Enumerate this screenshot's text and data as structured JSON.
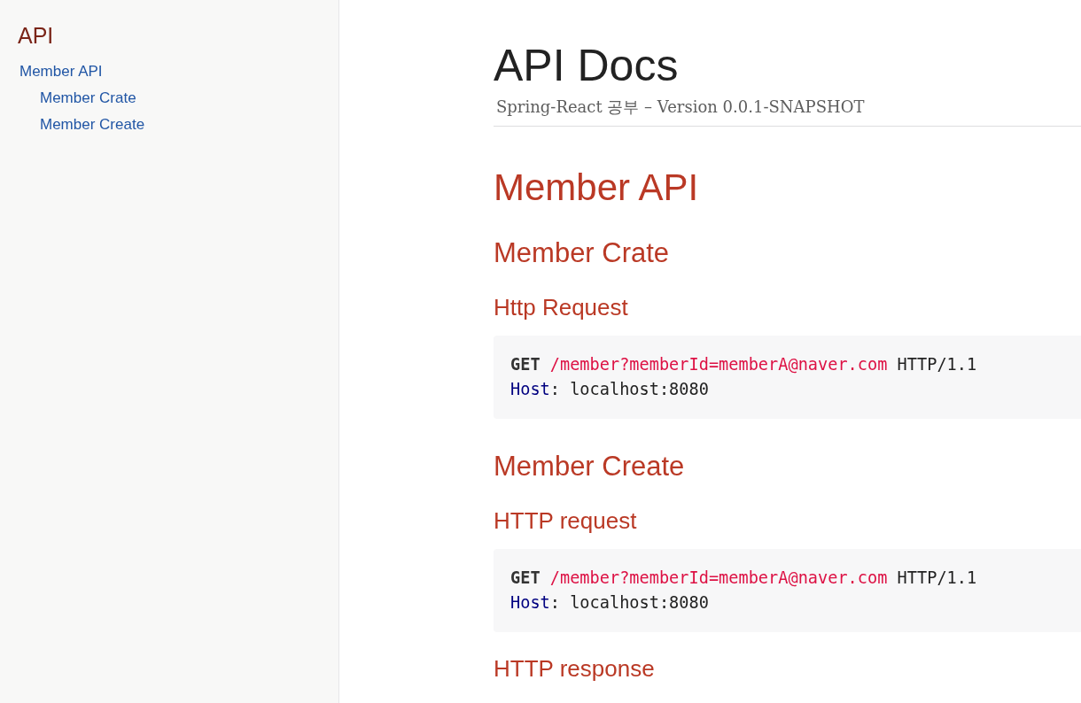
{
  "toc": {
    "title": "API",
    "items": [
      {
        "label": "Member API",
        "children": [
          {
            "label": "Member Crate"
          },
          {
            "label": "Member Create"
          }
        ]
      }
    ]
  },
  "header": {
    "title": "API Docs",
    "subtitle": "Spring-React 공부 – Version 0.0.1-SNAPSHOT"
  },
  "sections": [
    {
      "title": "Member API",
      "subsections": [
        {
          "title": "Member Crate",
          "blocks": [
            {
              "kind": "heading",
              "text": "Http Request"
            },
            {
              "kind": "code",
              "lines": [
                [
                  {
                    "kind": "method",
                    "text": "GET"
                  },
                  {
                    "kind": "path",
                    "text": " /member?memberId=memberA@naver.com"
                  },
                  {
                    "kind": "plain",
                    "text": " HTTP/1.1"
                  }
                ],
                [
                  {
                    "kind": "header",
                    "text": "Host"
                  },
                  {
                    "kind": "plain",
                    "text": ": localhost:8080"
                  }
                ]
              ]
            }
          ]
        },
        {
          "title": "Member Create",
          "blocks": [
            {
              "kind": "heading",
              "text": "HTTP request"
            },
            {
              "kind": "code",
              "lines": [
                [
                  {
                    "kind": "method",
                    "text": "GET"
                  },
                  {
                    "kind": "path",
                    "text": " /member?memberId=memberA@naver.com"
                  },
                  {
                    "kind": "plain",
                    "text": " HTTP/1.1"
                  }
                ],
                [
                  {
                    "kind": "header",
                    "text": "Host"
                  },
                  {
                    "kind": "plain",
                    "text": ": localhost:8080"
                  }
                ]
              ]
            },
            {
              "kind": "heading",
              "text": "HTTP response"
            }
          ]
        }
      ]
    }
  ]
}
